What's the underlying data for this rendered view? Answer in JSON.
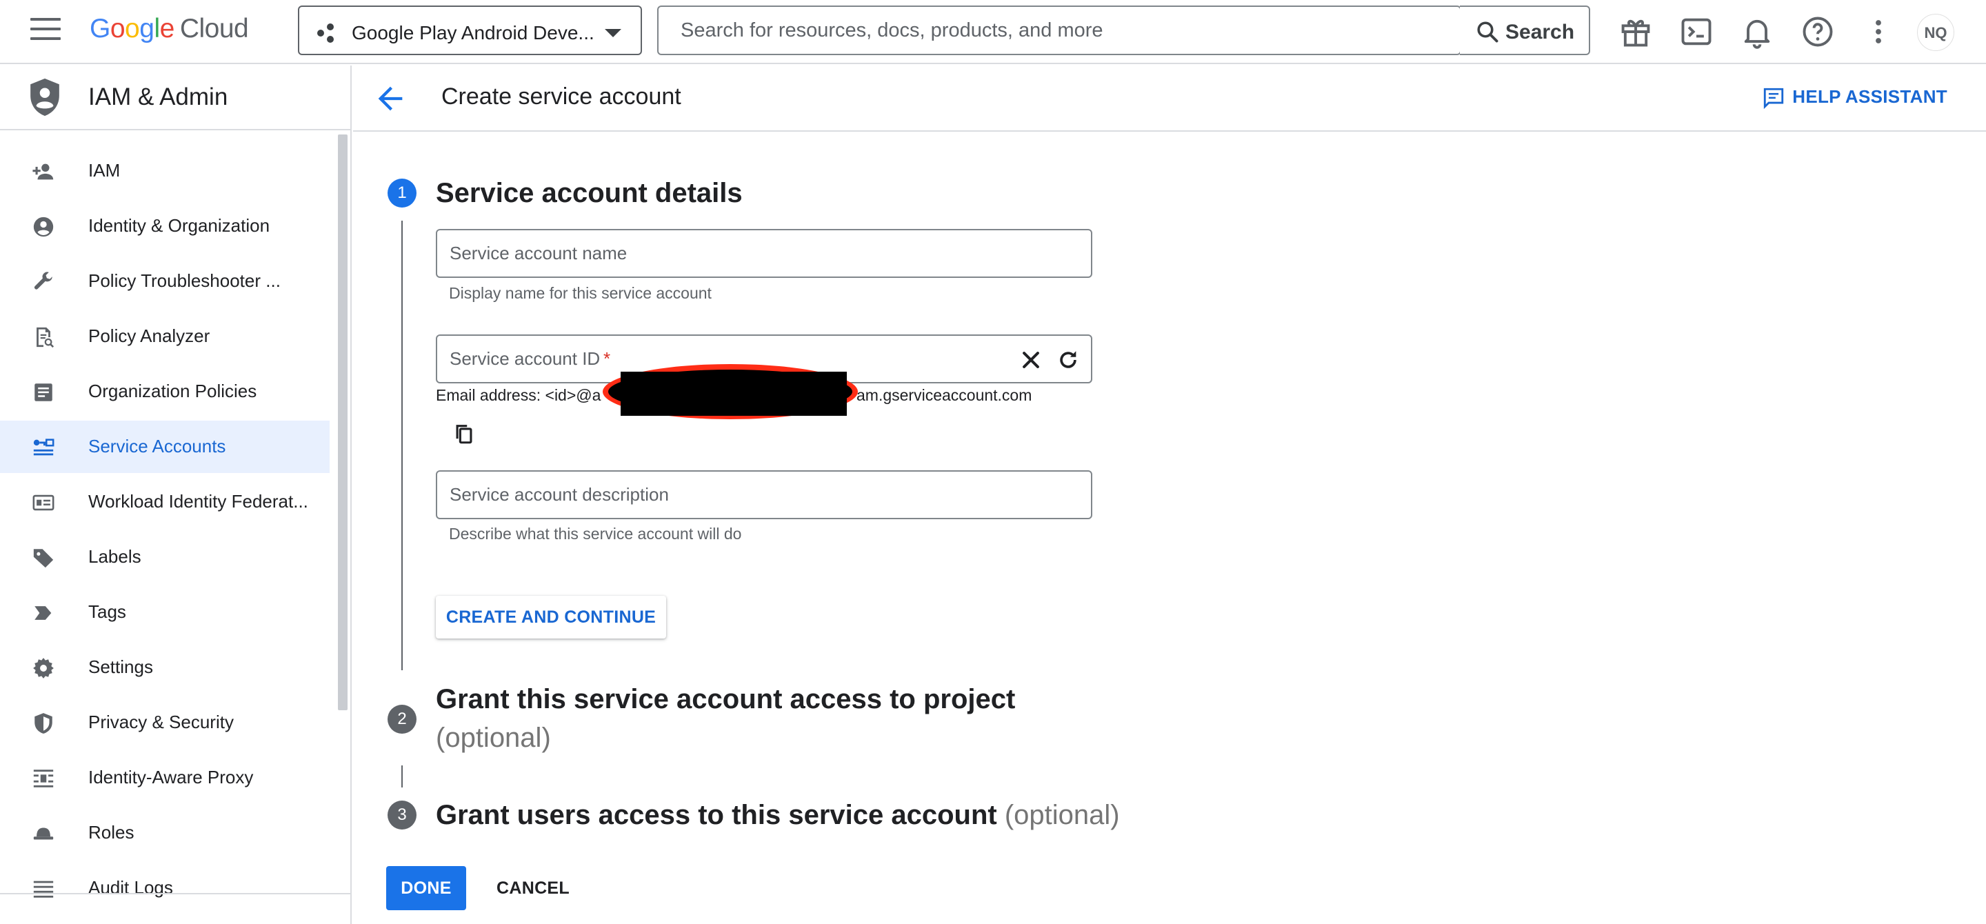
{
  "topbar": {
    "logo_letters": [
      "G",
      "o",
      "o",
      "g",
      "l",
      "e"
    ],
    "logo_suffix": "Cloud",
    "project": "Google Play Android Deve...",
    "search_placeholder": "Search for resources, docs, products, and more",
    "search_button": "Search",
    "avatar_text": "NQ",
    "icons": [
      "menu-icon",
      "gift-icon",
      "terminal-icon",
      "bell-icon",
      "help-circle-icon",
      "more-vert-icon"
    ]
  },
  "sidebar": {
    "title": "IAM & Admin",
    "items": [
      {
        "label": "IAM",
        "icon": "person-add-icon",
        "active": false
      },
      {
        "label": "Identity & Organization",
        "icon": "account-circle-icon",
        "active": false
      },
      {
        "label": "Policy Troubleshooter ...",
        "icon": "wrench-icon",
        "active": false
      },
      {
        "label": "Policy Analyzer",
        "icon": "policy-document-icon",
        "active": false
      },
      {
        "label": "Organization Policies",
        "icon": "article-icon",
        "active": false
      },
      {
        "label": "Service Accounts",
        "icon": "service-account-icon",
        "active": true
      },
      {
        "label": "Workload Identity Federat...",
        "icon": "id-card-icon",
        "active": false
      },
      {
        "label": "Labels",
        "icon": "label-tag-icon",
        "active": false
      },
      {
        "label": "Tags",
        "icon": "tag-chevron-icon",
        "active": false
      },
      {
        "label": "Settings",
        "icon": "gear-icon",
        "active": false
      },
      {
        "label": "Privacy & Security",
        "icon": "shield-icon",
        "active": false
      },
      {
        "label": "Identity-Aware Proxy",
        "icon": "proxy-icon",
        "active": false
      },
      {
        "label": "Roles",
        "icon": "hat-icon",
        "active": false
      },
      {
        "label": "Audit Logs",
        "icon": "list-lines-icon",
        "active": false
      }
    ]
  },
  "page": {
    "title": "Create service account",
    "help_assistant": "HELP ASSISTANT"
  },
  "steps": [
    {
      "number": "1",
      "title": "Service account details",
      "optional": ""
    },
    {
      "number": "2",
      "title": "Grant this service account access to project",
      "optional": "(optional)"
    },
    {
      "number": "3",
      "title": "Grant users access to this service account",
      "optional": "(optional)"
    }
  ],
  "form": {
    "name_placeholder": "Service account name",
    "name_hint": "Display name for this service account",
    "id_placeholder": "Service account ID",
    "id_required": "*",
    "email_prefix": "Email address: <id>@a",
    "email_suffix": "am.gserviceaccount.com",
    "description_placeholder": "Service account description",
    "description_hint": "Describe what this service account will do"
  },
  "buttons": {
    "create_continue": "CREATE AND CONTINUE",
    "done": "DONE",
    "cancel": "CANCEL"
  },
  "colors": {
    "accent": "#1a73e8",
    "active_nav_bg": "#e8f0fe",
    "active_nav_text": "#1967d2",
    "required": "#d93025",
    "redaction_ring": "#ff2d16"
  }
}
